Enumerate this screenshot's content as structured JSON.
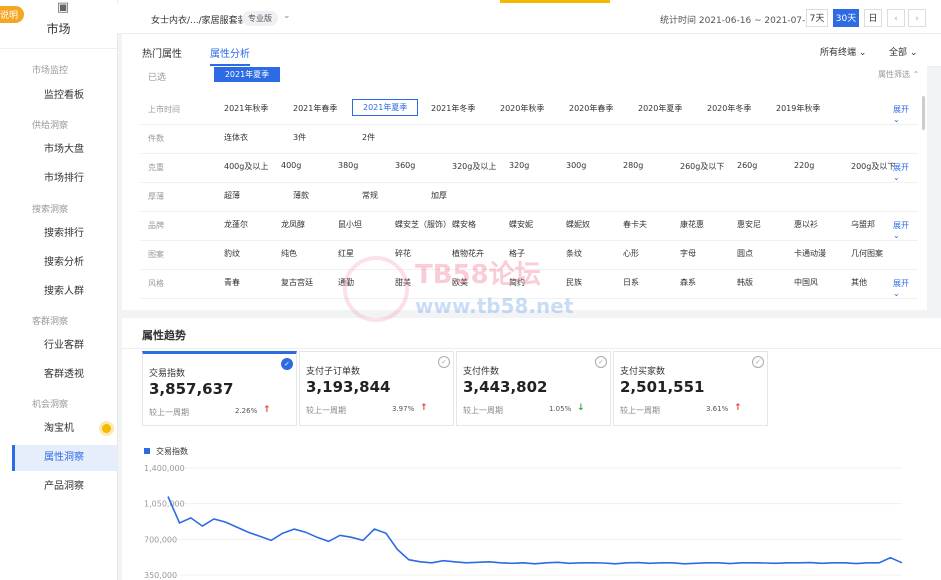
{
  "sidebar": {
    "badge": "说明",
    "title": "市场",
    "groups": [
      {
        "label": "市场监控",
        "items": [
          "监控看板"
        ]
      },
      {
        "label": "供给洞察",
        "items": [
          "市场大盘",
          "市场排行"
        ]
      },
      {
        "label": "搜索洞察",
        "items": [
          "搜索排行",
          "搜索分析",
          "搜索人群"
        ]
      },
      {
        "label": "客群洞察",
        "items": [
          "行业客群",
          "客群透视"
        ]
      },
      {
        "label": "机会洞察",
        "items": [
          "淘宝机",
          "属性洞察",
          "产品洞察"
        ]
      }
    ],
    "active": "属性洞察"
  },
  "header": {
    "breadcrumb": "女士内衣/.../家居服套装",
    "edition": "专业版",
    "stat_time": "统计时间 2021-06-16 ~ 2021-07-15",
    "ranges": [
      "7天",
      "30天",
      "日"
    ],
    "active_range": "30天"
  },
  "tabs": {
    "items": [
      "热门属性",
      "属性分析"
    ],
    "active": "属性分析",
    "terminal": "所有终端",
    "scope": "全部"
  },
  "filter": {
    "chosen_label": "已选",
    "chosen_tag": "2021年夏季",
    "attr_filter": "属性筛选",
    "expand": "展开",
    "rows": [
      {
        "label": "上市时间",
        "options": [
          "2021年秋季",
          "2021年春季",
          "2021年夏季",
          "2021年冬季",
          "2020年秋季",
          "2020年春季",
          "2020年夏季",
          "2020年冬季",
          "2019年秋季"
        ],
        "selected": "2021年夏季",
        "expandable": true
      },
      {
        "label": "件数",
        "options": [
          "连体衣",
          "3件",
          "2件"
        ],
        "expandable": false
      },
      {
        "label": "克重",
        "options": [
          "400g及以上",
          "400g",
          "380g",
          "360g",
          "320g及以上",
          "320g",
          "300g",
          "280g",
          "260g及以下",
          "260g",
          "220g",
          "200g及以下"
        ],
        "expandable": true
      },
      {
        "label": "厚薄",
        "options": [
          "超薄",
          "薄款",
          "常规",
          "加厚"
        ],
        "expandable": false
      },
      {
        "label": "品牌",
        "options": [
          "龙蓬尔",
          "龙凤醇",
          "鼠小坦",
          "蝶安芝（服饰）",
          "蝶安格",
          "蝶安妮",
          "蝶妮奴",
          "春卡夫",
          "康花惠",
          "惠安尼",
          "惠以衫",
          "乌盟邦"
        ],
        "expandable": true
      },
      {
        "label": "图案",
        "options": [
          "豹纹",
          "纯色",
          "红星",
          "碎花",
          "植物花卉",
          "格子",
          "条纹",
          "心形",
          "字母",
          "圆点",
          "卡通动漫",
          "几何图案"
        ],
        "expandable": false
      },
      {
        "label": "风格",
        "options": [
          "青春",
          "复古宫廷",
          "通勤",
          "甜美",
          "欧美",
          "简约",
          "民族",
          "日系",
          "森系",
          "韩版",
          "中国风",
          "其他"
        ],
        "expandable": true
      }
    ]
  },
  "trend": {
    "title": "属性趋势",
    "compare_label": "较上一周期",
    "kpis": [
      {
        "name": "交易指数",
        "value": "3,857,637",
        "pct": "2.26%",
        "dir": "up"
      },
      {
        "name": "支付子订单数",
        "value": "3,193,844",
        "pct": "3.97%",
        "dir": "up"
      },
      {
        "name": "支付件数",
        "value": "3,443,802",
        "pct": "1.05%",
        "dir": "down"
      },
      {
        "name": "支付买家数",
        "value": "2,501,551",
        "pct": "3.61%",
        "dir": "up"
      }
    ],
    "active_kpi": "交易指数"
  },
  "watermark": {
    "line1": "TB58论坛",
    "line2": "www.tb58.net"
  },
  "colors": {
    "accent": "#2d6be4",
    "up": "#e5453a",
    "down": "#2ea44f",
    "highlight": "#f5b800"
  },
  "chart_data": {
    "type": "line",
    "series": [
      {
        "name": "交易指数",
        "values": [
          1120000,
          860000,
          910000,
          830000,
          900000,
          870000,
          820000,
          770000,
          730000,
          690000,
          760000,
          800000,
          770000,
          720000,
          680000,
          740000,
          720000,
          690000,
          800000,
          760000,
          600000,
          500000,
          480000,
          470000,
          490000,
          480000,
          470000,
          475000,
          480000,
          470000,
          465000,
          470000,
          460000,
          470000,
          475000,
          465000,
          470000,
          470000,
          468000,
          460000,
          470000,
          472000,
          465000,
          470000,
          470000,
          460000,
          465000,
          470000,
          470000,
          462000,
          470000,
          470000,
          468000,
          465000,
          470000,
          470000,
          472000,
          465000,
          470000,
          470000,
          462000,
          470000,
          470000,
          520000,
          470000
        ]
      }
    ],
    "yticks": [
      "1,400,000",
      "1,050,000",
      "700,000",
      "350,000"
    ],
    "ylim": [
      350000,
      1400000
    ],
    "legend": "交易指数"
  }
}
